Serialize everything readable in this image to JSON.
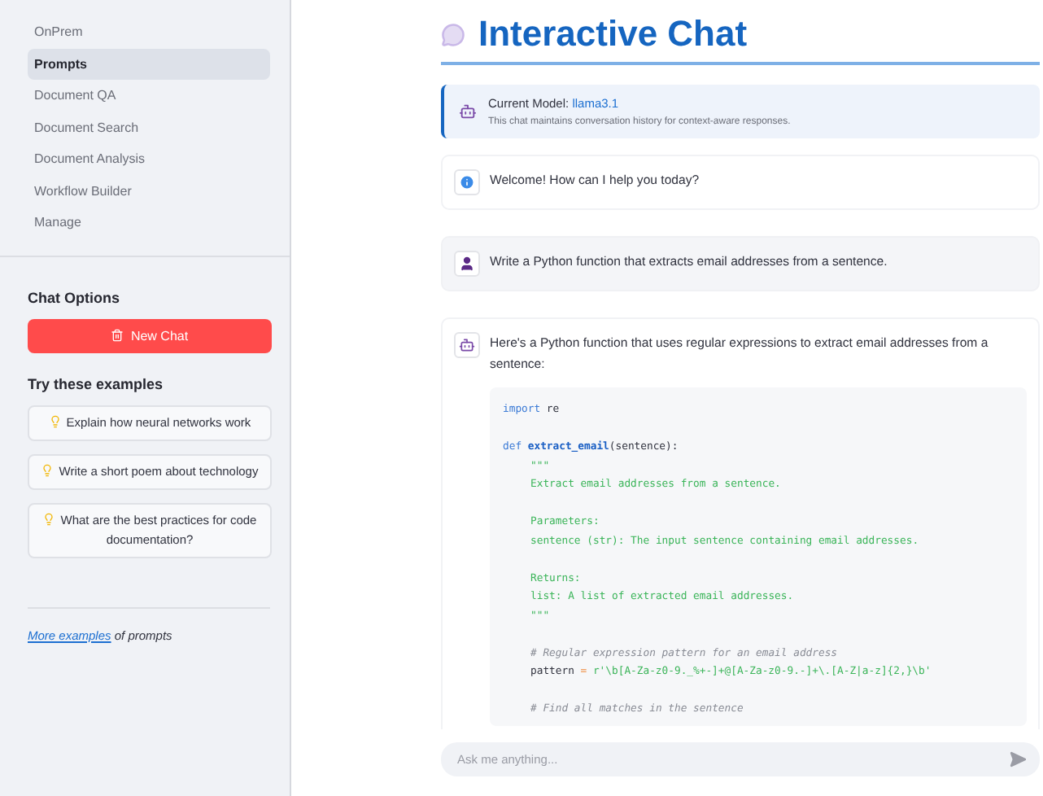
{
  "sidebar": {
    "nav": [
      {
        "label": "OnPrem",
        "selected": false
      },
      {
        "label": "Prompts",
        "selected": true
      },
      {
        "label": "Document QA",
        "selected": false
      },
      {
        "label": "Document Search",
        "selected": false
      },
      {
        "label": "Document Analysis",
        "selected": false
      },
      {
        "label": "Workflow Builder",
        "selected": false
      },
      {
        "label": "Manage",
        "selected": false
      }
    ],
    "options_title": "Chat Options",
    "new_chat": "New Chat",
    "examples_title": "Try these examples",
    "examples": [
      "Explain how neural networks work",
      "Write a short poem about technology",
      "What are the best practices for code documentation?"
    ],
    "more_link": "More examples",
    "more_rest": "of prompts"
  },
  "main": {
    "title": "Interactive Chat",
    "model_label": "Current Model:",
    "model": "llama3.1",
    "model_note": "This chat maintains conversation history for context-aware responses.",
    "messages": [
      {
        "kind": "info",
        "text": "Welcome! How can I help you today?"
      },
      {
        "kind": "user",
        "text": "Write a Python function that extracts email addresses from a sentence."
      },
      {
        "kind": "assistant",
        "text": "Here's a Python function that uses regular expressions to extract email addresses from a sentence:",
        "code": [
          {
            "indented": false,
            "gap_before": false,
            "tokens": [
              {
                "kind": "keyword",
                "text": "import"
              },
              {
                "kind": "plain",
                "text": "re"
              }
            ]
          },
          {
            "indented": false,
            "gap_before": true,
            "tokens": [
              {
                "kind": "keyword",
                "text": "def"
              },
              {
                "kind": "func",
                "text": "extract_email"
              },
              {
                "kind": "plain",
                "text": "(sentence):",
                "attached": true
              }
            ]
          },
          {
            "indented": true,
            "gap_before": false,
            "tokens": [
              {
                "kind": "string",
                "text": "\"\"\""
              }
            ]
          },
          {
            "indented": true,
            "gap_before": false,
            "tokens": [
              {
                "kind": "string",
                "text": "Extract email addresses from a sentence."
              }
            ]
          },
          {
            "indented": true,
            "gap_before": true,
            "tokens": [
              {
                "kind": "string",
                "text": "Parameters:"
              }
            ]
          },
          {
            "indented": true,
            "gap_before": false,
            "tokens": [
              {
                "kind": "string",
                "text": "sentence (str): The input sentence containing email addresses."
              }
            ]
          },
          {
            "indented": true,
            "gap_before": true,
            "tokens": [
              {
                "kind": "string",
                "text": "Returns:"
              }
            ]
          },
          {
            "indented": true,
            "gap_before": false,
            "tokens": [
              {
                "kind": "string",
                "text": "list: A list of extracted email addresses."
              }
            ]
          },
          {
            "indented": true,
            "gap_before": false,
            "tokens": [
              {
                "kind": "string",
                "text": "\"\"\""
              }
            ]
          },
          {
            "indented": true,
            "gap_before": true,
            "tokens": [
              {
                "kind": "comment",
                "text": "# Regular expression pattern for an email address"
              }
            ]
          },
          {
            "indented": true,
            "gap_before": false,
            "tokens": [
              {
                "kind": "plain",
                "text": "pattern"
              },
              {
                "kind": "op",
                "text": "="
              },
              {
                "kind": "string",
                "text": "r'\\b[A-Za-z0-9._%+-]+@[A-Za-z0-9.-]+\\.[A-Z|a-z]{2,}\\b'"
              }
            ]
          },
          {
            "indented": true,
            "gap_before": true,
            "tokens": [
              {
                "kind": "comment",
                "text": "# Find all matches in the sentence"
              }
            ]
          }
        ]
      }
    ],
    "input_placeholder": "Ask me anything..."
  }
}
